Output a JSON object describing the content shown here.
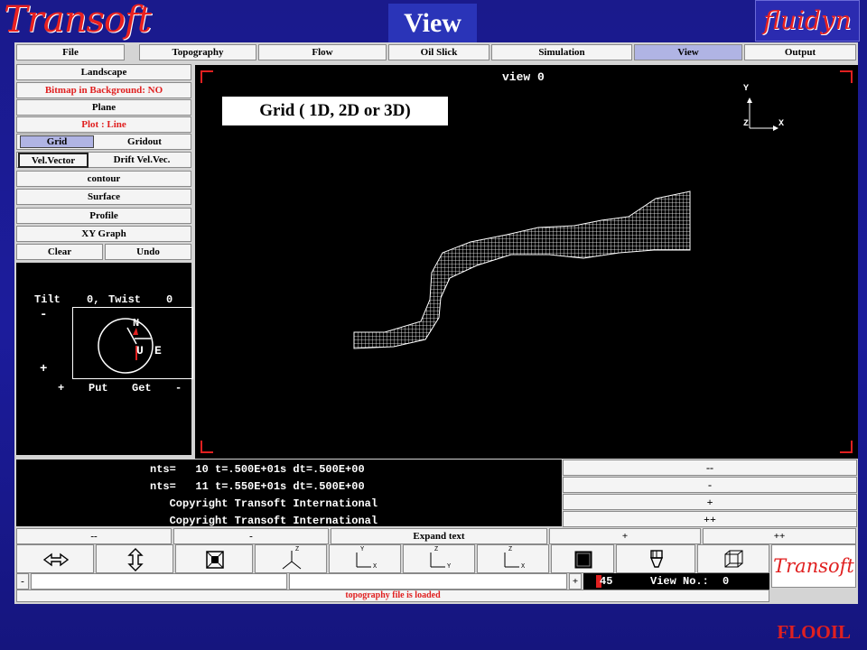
{
  "header": {
    "logo_left": "Transoft",
    "title": "View",
    "logo_right": "fluidyn"
  },
  "menu": [
    {
      "label": "File",
      "active": false
    },
    {
      "label": "Topography",
      "active": false
    },
    {
      "label": "Flow",
      "active": false
    },
    {
      "label": "Oil Slick",
      "active": false
    },
    {
      "label": "Simulation",
      "active": false
    },
    {
      "label": "View",
      "active": true
    },
    {
      "label": "Output",
      "active": false
    }
  ],
  "left_panel": {
    "landscape": "Landscape",
    "bitmap": "Bitmap in Background: NO",
    "plane": "Plane",
    "plot": "Plot : Line",
    "grid": "Grid",
    "gridout": "Gridout",
    "vel_vector": "Vel.Vector",
    "drift_vel": "Drift Vel.Vec.",
    "contour": "contour",
    "surface": "Surface",
    "profile": "Profile",
    "xy_graph": "XY Graph",
    "clear": "Clear",
    "undo": "Undo"
  },
  "orientation": {
    "tilt_label": "Tilt",
    "tilt_value": "0,",
    "twist_label": "Twist",
    "twist_value": "0",
    "minus": "-",
    "plus": "+",
    "north": "N",
    "up": "U",
    "east": "E",
    "put": "Put",
    "get": "Get",
    "plus_bottom": "+",
    "minus_bottom": "-"
  },
  "viewport": {
    "title": "view 0",
    "caption": "Grid  ( 1D, 2D or 3D)",
    "axis_y": "Y",
    "axis_z": "Z",
    "axis_x": "X"
  },
  "log": {
    "lines": [
      "nts=   10 t=.500E+01s dt=.500E+00",
      "nts=   11 t=.550E+01s dt=.500E+00",
      "   Copyright Transoft International",
      "   Copyright Transoft International"
    ]
  },
  "zoom_buttons": [
    "--",
    "-",
    "+",
    "++"
  ],
  "text_row": {
    "left_minus2": "--",
    "left_minus": "-",
    "expand": "Expand text",
    "plus": "+",
    "plus2": "++"
  },
  "tools": {
    "axis_z": "Z",
    "axis_y": "Y",
    "axis_x": "X"
  },
  "status": {
    "minus": "-",
    "plus": "+",
    "value": "45",
    "view_no_label": "View No.:",
    "view_no": "0",
    "message": "topography file is loaded",
    "logo": "Transoft"
  },
  "footer": "FLOOIL",
  "colors": {
    "background": "#1a1a8c",
    "accent_red": "#e02020",
    "active_menu": "#b0b4e4"
  }
}
